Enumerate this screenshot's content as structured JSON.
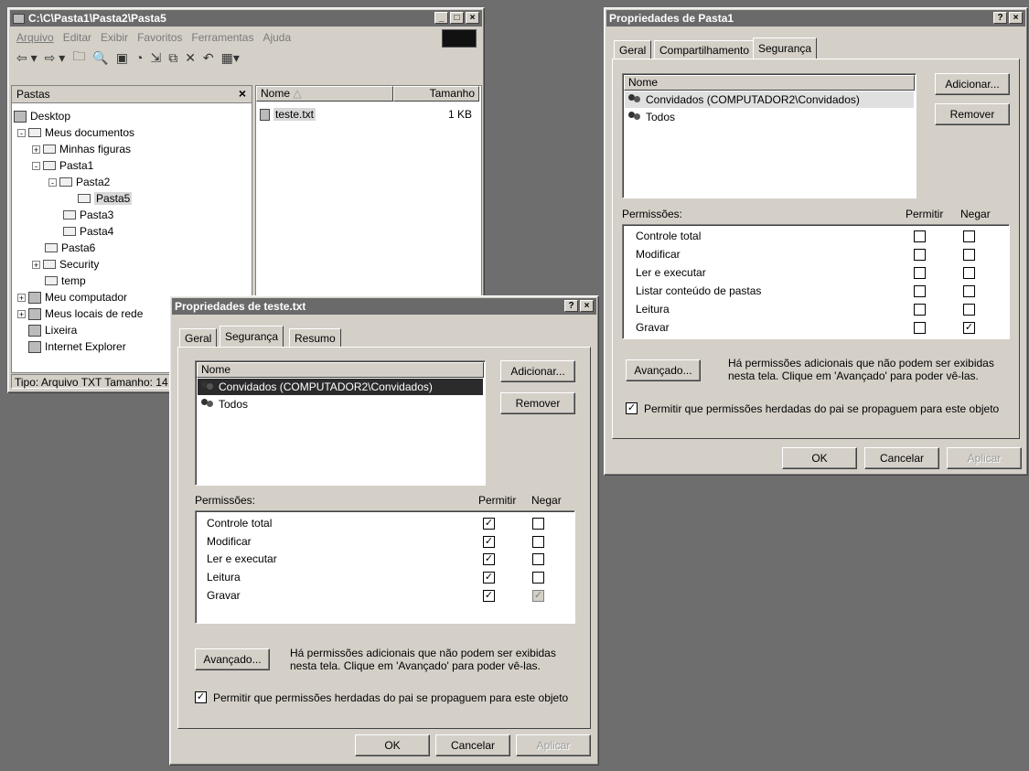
{
  "explorer": {
    "title": "C:\\C\\Pasta1\\Pasta2\\Pasta5",
    "menu": [
      "Arquivo",
      "Editar",
      "Exibir",
      "Favoritos",
      "Ferramentas",
      "Ajuda"
    ],
    "toolbar_icons": [
      "back-icon",
      "forward-icon",
      "up-folder-icon",
      "search-icon",
      "folders-icon",
      "history-icon",
      "move-to-icon",
      "copy-to-icon",
      "delete-icon",
      "undo-icon",
      "views-icon"
    ],
    "folders_pane_title": "Pastas",
    "folders_close": "×",
    "tree": [
      {
        "label": "Desktop"
      },
      {
        "label": "Meus documentos"
      },
      {
        "label": "Minhas figuras"
      },
      {
        "label": "Pasta1"
      },
      {
        "label": "Pasta2"
      },
      {
        "label": "Pasta5"
      },
      {
        "label": "Pasta3"
      },
      {
        "label": "Pasta4"
      },
      {
        "label": "Pasta6"
      },
      {
        "label": "Security"
      },
      {
        "label": "temp"
      },
      {
        "label": "Meu computador"
      },
      {
        "label": "Meus locais de rede"
      },
      {
        "label": "Lixeira"
      },
      {
        "label": "Internet Explorer"
      }
    ],
    "columns": {
      "name": "Nome",
      "size": "Tamanho"
    },
    "files": [
      {
        "name": "teste.txt",
        "size": "1 KB"
      }
    ],
    "status": "Tipo: Arquivo TXT Tamanho: 14"
  },
  "dialog_file": {
    "title": "Propriedades de teste.txt",
    "help_btn": "?",
    "close_btn": "×",
    "tabs": [
      "Geral",
      "Segurança",
      "Resumo"
    ],
    "name_header": "Nome",
    "users": [
      "Convidados (COMPUTADOR2\\Convidados)",
      "Todos"
    ],
    "add_button": "Adicionar...",
    "remove_button": "Remover",
    "perm_label": "Permissões:",
    "allow_label": "Permitir",
    "deny_label": "Negar",
    "permissions": [
      {
        "name": "Controle total",
        "allow": true,
        "deny": false
      },
      {
        "name": "Modificar",
        "allow": true,
        "deny": false
      },
      {
        "name": "Ler e executar",
        "allow": true,
        "deny": false
      },
      {
        "name": "Leitura",
        "allow": true,
        "deny": false
      },
      {
        "name": "Gravar",
        "allow": true,
        "deny": true
      }
    ],
    "advanced_button": "Avançado...",
    "advanced_text_1": "Há permissões adicionais que não podem ser exibidas",
    "advanced_text_2": "nesta tela. Clique em 'Avançado' para poder vê-las.",
    "inherit_text": "Permitir que permissões herdadas do pai se propaguem para este objeto",
    "ok": "OK",
    "cancel": "Cancelar",
    "apply": "Aplicar"
  },
  "dialog_folder": {
    "title": "Propriedades de Pasta1",
    "help_btn": "?",
    "close_btn": "×",
    "tabs": [
      "Geral",
      "Compartilhamento",
      "Segurança"
    ],
    "name_header": "Nome",
    "users": [
      "Convidados (COMPUTADOR2\\Convidados)",
      "Todos"
    ],
    "add_button": "Adicionar...",
    "remove_button": "Remover",
    "perm_label": "Permissões:",
    "allow_label": "Permitir",
    "deny_label": "Negar",
    "permissions": [
      {
        "name": "Controle total",
        "allow": false,
        "deny": false
      },
      {
        "name": "Modificar",
        "allow": false,
        "deny": false
      },
      {
        "name": "Ler e executar",
        "allow": false,
        "deny": false
      },
      {
        "name": "Listar conteúdo de pastas",
        "allow": false,
        "deny": false
      },
      {
        "name": "Leitura",
        "allow": false,
        "deny": false
      },
      {
        "name": "Gravar",
        "allow": false,
        "deny": true
      }
    ],
    "advanced_button": "Avançado...",
    "advanced_text_1": "Há permissões adicionais que não podem ser exibidas",
    "advanced_text_2": "nesta tela. Clique em 'Avançado' para poder vê-las.",
    "inherit_text": "Permitir que permissões herdadas do pai se propaguem para este objeto",
    "ok": "OK",
    "cancel": "Cancelar",
    "apply": "Aplicar"
  }
}
